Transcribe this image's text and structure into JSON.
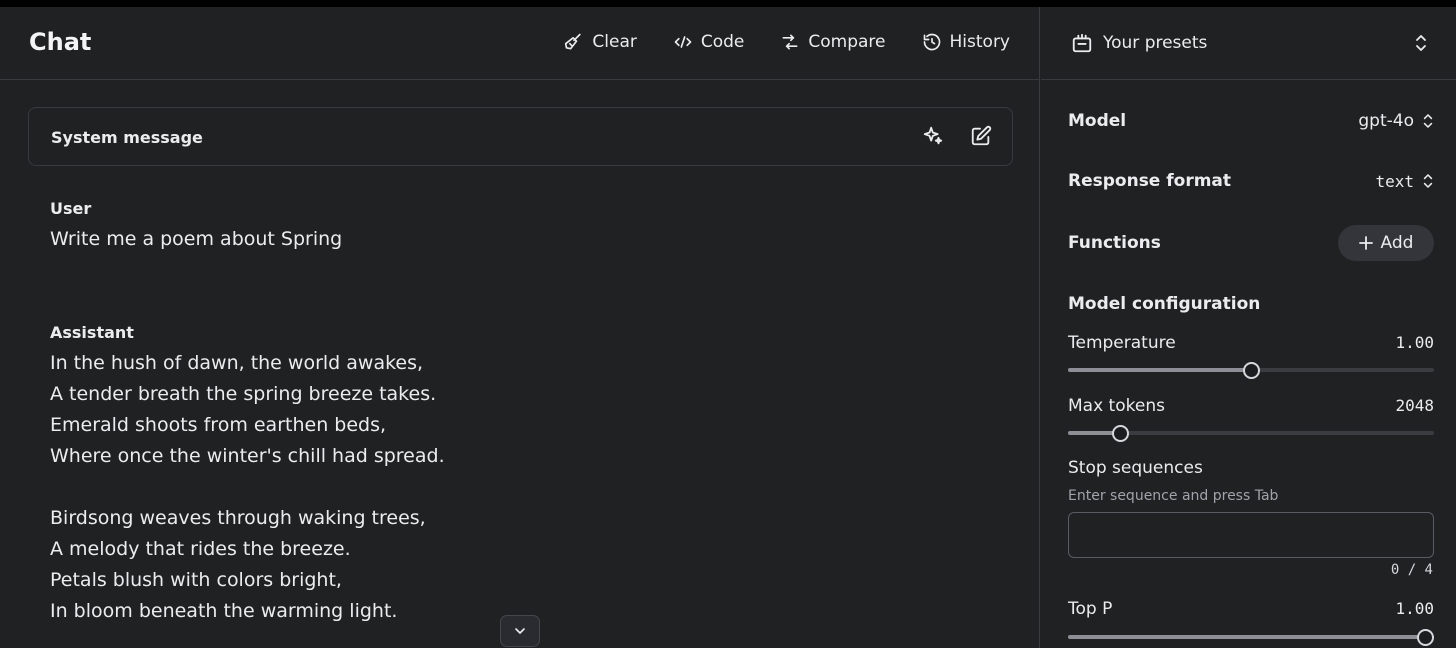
{
  "header": {
    "title": "Chat",
    "toolbar": [
      {
        "label": "Clear",
        "icon": "broom-icon"
      },
      {
        "label": "Code",
        "icon": "code-icon"
      },
      {
        "label": "Compare",
        "icon": "compare-icon"
      },
      {
        "label": "History",
        "icon": "history-icon"
      }
    ]
  },
  "system_message": {
    "label": "System message"
  },
  "messages": [
    {
      "role": "User",
      "text": "Write me a poem about Spring"
    },
    {
      "role": "Assistant",
      "text": "In the hush of dawn, the world awakes,\nA tender breath the spring breeze takes.\nEmerald shoots from earthen beds,\nWhere once the winter's chill had spread.\n\nBirdsong weaves through waking trees,\nA melody that rides the breeze.\nPetals blush with colors bright,\nIn bloom beneath the warming light."
    }
  ],
  "sidebar": {
    "presets_label": "Your presets",
    "model": {
      "label": "Model",
      "value": "gpt-4o"
    },
    "response_format": {
      "label": "Response format",
      "value": "text"
    },
    "functions": {
      "label": "Functions",
      "add_label": "Add"
    },
    "model_configuration": "Model configuration",
    "temperature": {
      "label": "Temperature",
      "value": "1.00",
      "fraction": 0.5
    },
    "max_tokens": {
      "label": "Max tokens",
      "value": "2048",
      "fraction": 0.143
    },
    "stop_sequences": {
      "label": "Stop sequences",
      "hint": "Enter sequence and press Tab",
      "counter": "0 / 4"
    },
    "top_p": {
      "label": "Top P",
      "value": "1.00",
      "fraction": 1.0
    }
  }
}
